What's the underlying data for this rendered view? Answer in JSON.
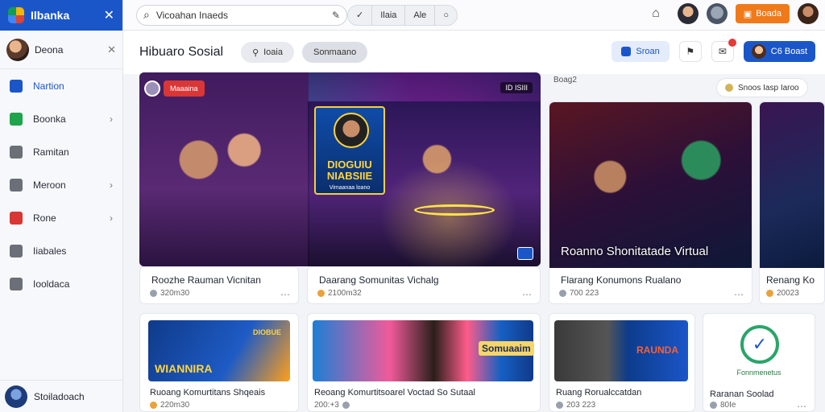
{
  "app": {
    "brand": "Ilbanka"
  },
  "sidebar": {
    "user_name": "Deona",
    "items": [
      {
        "label": "Nartion",
        "color": "#1b56c9",
        "active": true,
        "chevron": ""
      },
      {
        "label": "Boonka",
        "color": "#1ea44a",
        "active": false,
        "chevron": "›"
      },
      {
        "label": "Ramitan",
        "color": "#6b6f78",
        "active": false,
        "chevron": ""
      },
      {
        "label": "Meroon",
        "color": "#6b6f78",
        "active": false,
        "chevron": "›"
      },
      {
        "label": "Rone",
        "color": "#d93636",
        "active": false,
        "chevron": "›"
      },
      {
        "label": "Iiabales",
        "color": "#6b6f78",
        "active": false,
        "chevron": ""
      },
      {
        "label": "Iooldaca",
        "color": "#6b6f78",
        "active": false,
        "chevron": ""
      }
    ],
    "footer_name": "Stoiladoach"
  },
  "topbar": {
    "search_value": "Vicoahan Inaeds",
    "segments": [
      "Ilaia",
      "Ale"
    ],
    "upgrade_label": "Boada"
  },
  "header": {
    "title": "Hibuaro Sosial",
    "chips": [
      "Ioaia",
      "Sonmaano"
    ],
    "blue_pill": "Sroan",
    "join_label": "C6 Boast"
  },
  "featured": {
    "tag": "Maaaina",
    "corner_text": "ID ISIII",
    "poster_title": "DIOGUIU NIABSIIE",
    "poster_sub": "Vimaanaa loano",
    "card1_title": "Roozhe Rauman Vicnitan",
    "card1_meta": "320m30",
    "card2_title": "Daarang Somunitas Vichalg",
    "card2_meta": "2100m32"
  },
  "strip": {
    "text": "Boag2",
    "button": "Snoos Iasp Iaroo"
  },
  "cards_row1": [
    {
      "title": "Flarang Konumons Rualano",
      "meta": "700 223",
      "overlay": "Roanno Shonitatade Virtual"
    },
    {
      "title": "Renang Ko",
      "meta": "20023",
      "overlay": ""
    }
  ],
  "cards_row2": [
    {
      "title": "Ruoang Komurtitans Shqeais",
      "meta": "220m30",
      "poster": "WIANNIRA",
      "poster_sub": "DIOBUE"
    },
    {
      "title": "Reoang Komurtitsoarel Voctad So Sutaal",
      "meta": "200:+3",
      "poster": "Somuaaim",
      "poster_sub": ""
    },
    {
      "title": "Ruang Rorualccatdan",
      "meta": "203 223",
      "poster": "RAUNDA",
      "poster_sub": ""
    },
    {
      "title": "Raranan Soolad",
      "meta": "80Ie",
      "poster": "Fonnmenetus",
      "poster_sub": ""
    }
  ],
  "colors": {
    "accent": "#1b56c9",
    "orange": "#f07a1a",
    "alert": "#d93636"
  }
}
